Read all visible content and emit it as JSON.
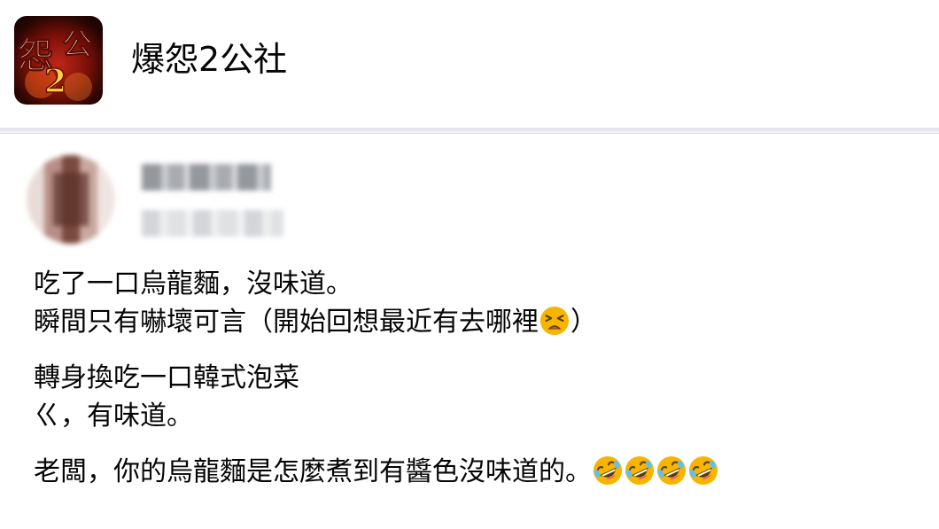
{
  "group": {
    "name": "爆怨2公社",
    "avatar_text": "怨2公"
  },
  "post": {
    "author_name": "",
    "lines": {
      "l1": "吃了一口烏龍麵，沒味道。",
      "l2_before": "瞬間只有嚇壞可言（開始回想最近有去哪裡",
      "l2_after": "）",
      "l3": "轉身換吃一口韓式泡菜",
      "l4": "ㄍ，有味道。",
      "l5": "老闆，你的烏龍麵是怎麼煮到有醬色沒味道的。"
    },
    "emojis": {
      "tired": "tired-face-emoji",
      "laughing": "rolling-on-floor-laughing-emoji",
      "laughing_count": 4
    }
  },
  "colors": {
    "text": "#050505",
    "background": "#f0f2f5",
    "card": "#ffffff",
    "emoji_yellow": "#f7b500"
  }
}
